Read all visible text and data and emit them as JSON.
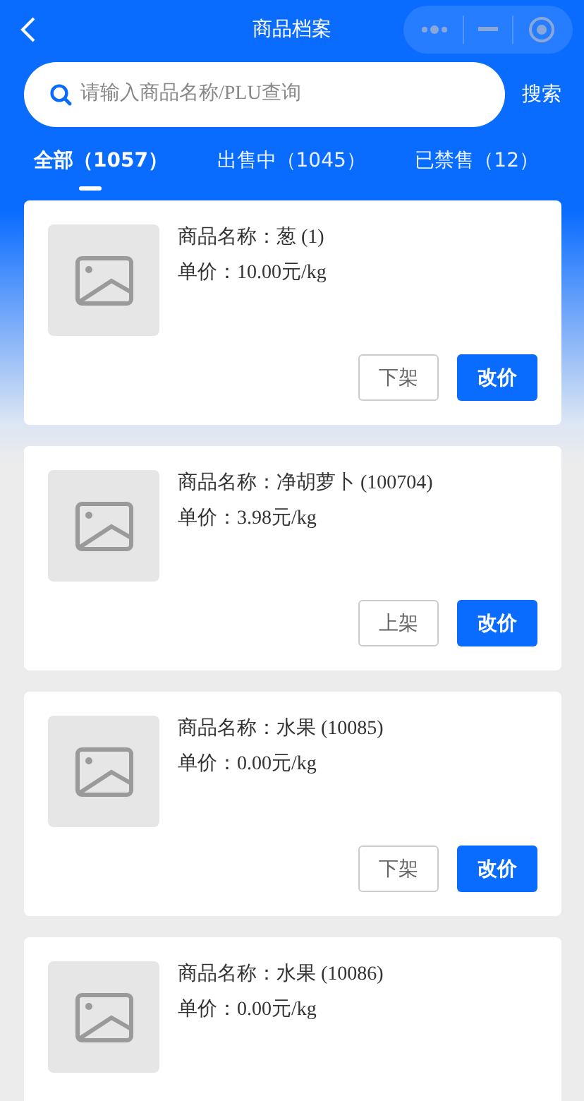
{
  "nav": {
    "title": "商品档案"
  },
  "search": {
    "placeholder": "请输入商品名称/PLU查询",
    "button": "搜索"
  },
  "tabs": [
    {
      "label": "全部（1057）",
      "selected": true
    },
    {
      "label": "出售中（1045）",
      "selected": false
    },
    {
      "label": "已禁售（12）",
      "selected": false
    }
  ],
  "products": [
    {
      "name": "商品名称：葱 (1)",
      "price": "单价：10.00元/kg",
      "buttons": [
        "下架",
        "改价"
      ]
    },
    {
      "name": "商品名称：净胡萝卜 (100704)",
      "price": "单价：3.98元/kg",
      "buttons": [
        "上架",
        "改价"
      ]
    },
    {
      "name": "商品名称：水果 (10085)",
      "price": "单价：0.00元/kg",
      "buttons": [
        "下架",
        "改价"
      ]
    },
    {
      "name": "商品名称：水果 (10086)",
      "price": "单价：0.00元/kg"
    }
  ]
}
